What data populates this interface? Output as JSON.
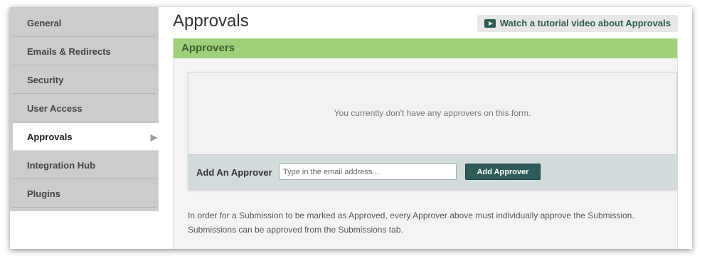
{
  "sidebar": {
    "items": [
      {
        "label": "General"
      },
      {
        "label": "Emails & Redirects"
      },
      {
        "label": "Security"
      },
      {
        "label": "User Access"
      },
      {
        "label": "Approvals",
        "active": true
      },
      {
        "label": "Integration Hub"
      },
      {
        "label": "Plugins"
      }
    ],
    "active_arrow": "▶"
  },
  "header": {
    "title": "Approvals",
    "tutorial_label": "Watch a tutorial video about Approvals"
  },
  "panel": {
    "title": "Approvers",
    "empty_message": "You currently don't have any approvers on this form.",
    "add_label": "Add An Approver",
    "email_placeholder": "Type in the email address...",
    "add_button_label": "Add Approver",
    "help_text": "In order for a Submission to be marked as Approved, every Approver above must individually approve the Submission. Submissions can be approved from the Submissions tab."
  },
  "colors": {
    "panel_header_bg": "#9fd07a",
    "button_bg": "#2e5b57",
    "sidebar_bg": "#cccccc"
  }
}
